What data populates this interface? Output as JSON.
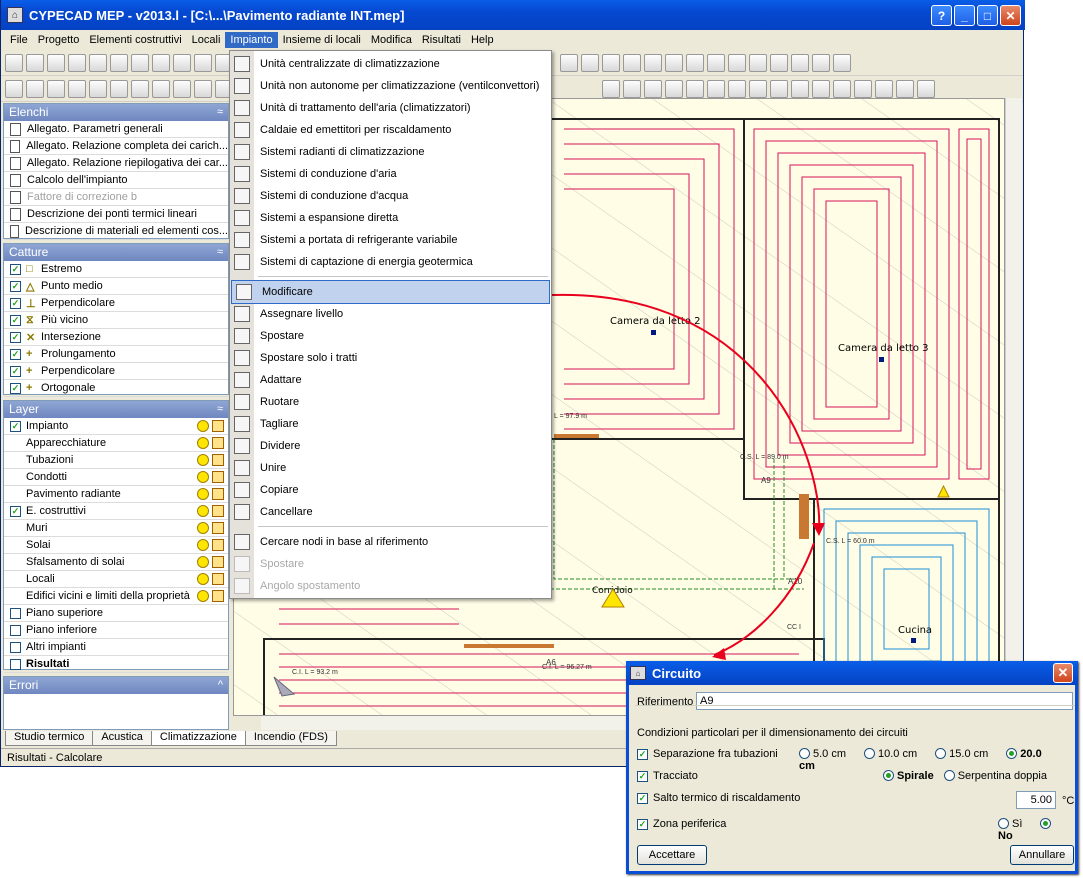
{
  "window": {
    "title": "CYPECAD MEP - v2013.l - [C:\\...\\Pavimento radiante INT.mep]",
    "icon": "cype-app-icon"
  },
  "menubar": [
    "File",
    "Progetto",
    "Elementi costruttivi",
    "Locali",
    "Impianto",
    "Insieme di locali",
    "Modifica",
    "Risultati",
    "Help"
  ],
  "active_menu_index": 4,
  "panels": {
    "elenchi": {
      "title": "Elenchi",
      "items": [
        {
          "label": "Allegato. Parametri generali",
          "enabled": true
        },
        {
          "label": "Allegato. Relazione completa dei carich...",
          "enabled": true
        },
        {
          "label": "Allegato. Relazione riepilogativa dei car...",
          "enabled": true
        },
        {
          "label": "Calcolo dell'impianto",
          "enabled": true
        },
        {
          "label": "Fattore di correzione b",
          "enabled": false
        },
        {
          "label": "Descrizione dei ponti termici lineari",
          "enabled": true
        },
        {
          "label": "Descrizione di materiali ed elementi cos...",
          "enabled": true
        }
      ]
    },
    "catture": {
      "title": "Catture",
      "items": [
        {
          "label": "Estremo",
          "checked": true
        },
        {
          "label": "Punto medio",
          "checked": true
        },
        {
          "label": "Perpendicolare",
          "checked": true
        },
        {
          "label": "Più vicino",
          "checked": true
        },
        {
          "label": "Intersezione",
          "checked": true
        },
        {
          "label": "Prolungamento",
          "checked": true
        },
        {
          "label": "Perpendicolare",
          "checked": true
        },
        {
          "label": "Ortogonale",
          "checked": true
        }
      ]
    },
    "layer": {
      "title": "Layer",
      "items": [
        {
          "label": "Impianto",
          "checked": true,
          "check": true,
          "icons": true
        },
        {
          "label": "Apparecchiature",
          "check": false,
          "icons": true
        },
        {
          "label": "Tubazioni",
          "check": false,
          "icons": true
        },
        {
          "label": "Condotti",
          "check": false,
          "icons": true
        },
        {
          "label": "Pavimento radiante",
          "check": false,
          "icons": true
        },
        {
          "label": "E. costruttivi",
          "checked": true,
          "check": true,
          "icons": true
        },
        {
          "label": "Muri",
          "check": false,
          "icons": true
        },
        {
          "label": "Solai",
          "check": false,
          "icons": true
        },
        {
          "label": "Sfalsamento di solai",
          "check": false,
          "icons": true
        },
        {
          "label": "Locali",
          "check": false,
          "icons": true
        },
        {
          "label": "Edifici vicini e limiti della proprietà",
          "check": false,
          "icons": true
        },
        {
          "label": "Piano superiore",
          "checked": false,
          "check": true,
          "icons": false
        },
        {
          "label": "Piano inferiore",
          "checked": false,
          "check": true,
          "icons": false
        },
        {
          "label": "Altri impianti",
          "checked": false,
          "check": true,
          "icons": false
        },
        {
          "label": "Risultati",
          "checked": false,
          "check": true,
          "icons": false,
          "bold": true
        }
      ]
    },
    "errori": {
      "title": "Errori"
    }
  },
  "dropdown": {
    "items": [
      {
        "label": "Unità centralizzate di climatizzazione",
        "enabled": true
      },
      {
        "label": "Unità non autonome per climatizzazione (ventilconvettori)",
        "enabled": true
      },
      {
        "label": "Unità di trattamento dell'aria (climatizzatori)",
        "enabled": true
      },
      {
        "label": "Caldaie ed emettitori per riscaldamento",
        "enabled": true
      },
      {
        "label": "Sistemi radianti di climatizzazione",
        "enabled": true
      },
      {
        "label": "Sistemi di conduzione d'aria",
        "enabled": true
      },
      {
        "label": "Sistemi di conduzione d'acqua",
        "enabled": true
      },
      {
        "label": "Sistemi a espansione diretta",
        "enabled": true
      },
      {
        "label": "Sistemi a portata di refrigerante variabile",
        "enabled": true
      },
      {
        "label": "Sistemi di captazione di energia geotermica",
        "enabled": true
      },
      {
        "label": "Modificare",
        "enabled": true,
        "highlight": true
      },
      {
        "label": "Assegnare livello",
        "enabled": true
      },
      {
        "label": "Spostare",
        "enabled": true
      },
      {
        "label": "Spostare solo i tratti",
        "enabled": true
      },
      {
        "label": "Adattare",
        "enabled": true
      },
      {
        "label": "Ruotare",
        "enabled": true
      },
      {
        "label": "Tagliare",
        "enabled": true
      },
      {
        "label": "Dividere",
        "enabled": true
      },
      {
        "label": "Unire",
        "enabled": true
      },
      {
        "label": "Copiare",
        "enabled": true
      },
      {
        "label": "Cancellare",
        "enabled": true
      },
      {
        "label": "Cercare nodi in base al riferimento",
        "enabled": true
      },
      {
        "label": "Spostare",
        "enabled": false
      },
      {
        "label": "Angolo spostamento",
        "enabled": false
      }
    ]
  },
  "canvas": {
    "rooms": [
      "Camera da letto 2",
      "Camera da letto 3",
      "Cucina",
      "Corridoio"
    ],
    "tags": [
      "L = 97.9 m",
      "C.S. L = 89.0 m",
      "C.S. L = 60.0 m",
      "C.I. L = 93.2 m",
      "C.I. L = 96.27 m",
      "A9",
      "A10",
      "A6",
      "CC I"
    ]
  },
  "tabs": [
    "Studio termico",
    "Acustica",
    "Climatizzazione",
    "Incendio (FDS)"
  ],
  "selected_tab": 2,
  "status": "Risultati - Calcolare",
  "dialog": {
    "title": "Circuito",
    "riferimento_label": "Riferimento",
    "riferimento_value": "A9",
    "section_title": "Condizioni particolari per il dimensionamento dei circuiti",
    "separazione": {
      "label": "Separazione fra tubazioni",
      "options": [
        "5.0 cm",
        "10.0 cm",
        "15.0 cm",
        "20.0 cm"
      ],
      "selected": 3
    },
    "tracciato": {
      "label": "Tracciato",
      "options": [
        "Spirale",
        "Serpentina doppia"
      ],
      "selected": 0
    },
    "salto": {
      "label": "Salto termico di riscaldamento",
      "value": "5.00",
      "unit": "°C"
    },
    "zona": {
      "label": "Zona periferica",
      "options": [
        "Sì",
        "No"
      ],
      "selected": 1
    },
    "ok_label": "Accettare",
    "cancel_label": "Annullare"
  },
  "colors": {
    "title_blue": "#0548d0",
    "panel_head": "#7a91c8",
    "heating_red": "#d4145a",
    "cooling_blue": "#1e90d8",
    "arrow_red": "#e8001c"
  }
}
